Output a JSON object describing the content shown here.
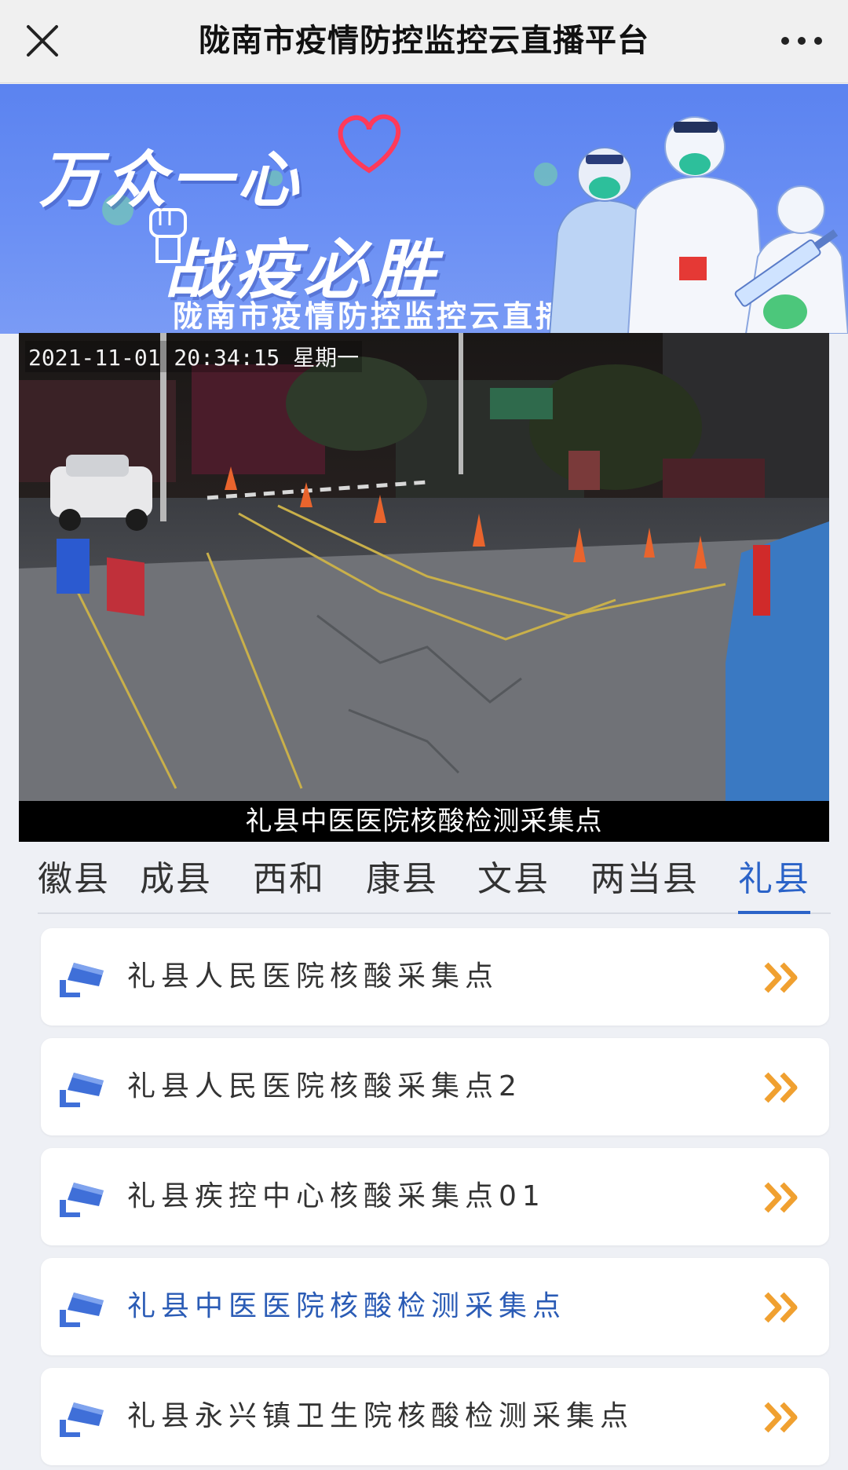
{
  "navbar": {
    "title": "陇南市疫情防控监控云直播平台"
  },
  "banner": {
    "slogan_line1": "万众一心",
    "slogan_line2": "战疫必胜",
    "subtitle": "陇南市疫情防控监控云直播平台"
  },
  "video": {
    "timestamp": "2021-11-01 20:34:15 星期一",
    "caption": "礼县中医医院核酸检测采集点"
  },
  "tabs": [
    {
      "label": "徽县"
    },
    {
      "label": "成县"
    },
    {
      "label": "西和"
    },
    {
      "label": "康县"
    },
    {
      "label": "文县"
    },
    {
      "label": "两当县"
    },
    {
      "label": "礼县"
    }
  ],
  "active_tab": "礼县",
  "sites": [
    {
      "label": "礼县人民医院核酸采集点"
    },
    {
      "label": "礼县人民医院核酸采集点2"
    },
    {
      "label": "礼县疾控中心核酸采集点01"
    },
    {
      "label": "礼县中医医院核酸检测采集点"
    },
    {
      "label": "礼县永兴镇卫生院核酸检测采集点"
    }
  ],
  "colors": {
    "accent": "#2b63c8",
    "arrow": "#f0a030",
    "banner": "#6a8ff4"
  }
}
